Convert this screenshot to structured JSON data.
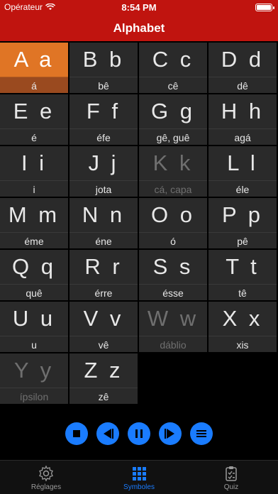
{
  "status_bar": {
    "carrier": "Opérateur",
    "time": "8:54 PM"
  },
  "nav": {
    "title": "Alphabet"
  },
  "alphabet": [
    {
      "letters": "A a",
      "name": "á",
      "state": "active"
    },
    {
      "letters": "B b",
      "name": "bê",
      "state": "normal"
    },
    {
      "letters": "C c",
      "name": "cê",
      "state": "normal"
    },
    {
      "letters": "D d",
      "name": "dê",
      "state": "normal"
    },
    {
      "letters": "E e",
      "name": "é",
      "state": "normal"
    },
    {
      "letters": "F f",
      "name": "éfe",
      "state": "normal"
    },
    {
      "letters": "G g",
      "name": "gê, guê",
      "state": "normal"
    },
    {
      "letters": "H h",
      "name": "agá",
      "state": "normal"
    },
    {
      "letters": "I i",
      "name": "i",
      "state": "normal"
    },
    {
      "letters": "J j",
      "name": "jota",
      "state": "normal"
    },
    {
      "letters": "K k",
      "name": "cá, capa",
      "state": "dim"
    },
    {
      "letters": "L l",
      "name": "éle",
      "state": "normal"
    },
    {
      "letters": "M m",
      "name": "éme",
      "state": "normal"
    },
    {
      "letters": "N n",
      "name": "éne",
      "state": "normal"
    },
    {
      "letters": "O o",
      "name": "ó",
      "state": "normal"
    },
    {
      "letters": "P p",
      "name": "pê",
      "state": "normal"
    },
    {
      "letters": "Q q",
      "name": "quê",
      "state": "normal"
    },
    {
      "letters": "R r",
      "name": "érre",
      "state": "normal"
    },
    {
      "letters": "S s",
      "name": "ésse",
      "state": "normal"
    },
    {
      "letters": "T t",
      "name": "tê",
      "state": "normal"
    },
    {
      "letters": "U u",
      "name": "u",
      "state": "normal"
    },
    {
      "letters": "V v",
      "name": "vê",
      "state": "normal"
    },
    {
      "letters": "W w",
      "name": "dáblio",
      "state": "dim"
    },
    {
      "letters": "X x",
      "name": "xis",
      "state": "normal"
    },
    {
      "letters": "Y y",
      "name": "ípsilon",
      "state": "dim"
    },
    {
      "letters": "Z z",
      "name": "zê",
      "state": "normal"
    }
  ],
  "controls": [
    "stop-icon",
    "previous-icon",
    "pause-icon",
    "next-icon",
    "list-icon"
  ],
  "tabs": [
    {
      "label": "Réglages",
      "icon": "gear-icon",
      "active": false
    },
    {
      "label": "Symboles",
      "icon": "grid-icon",
      "active": true
    },
    {
      "label": "Quiz",
      "icon": "clipboard-icon",
      "active": false
    }
  ],
  "colors": {
    "header": "#c0140f",
    "active_cell": "#e07525",
    "accent": "#1a7cff",
    "dim_text": "#6f6f6f"
  }
}
